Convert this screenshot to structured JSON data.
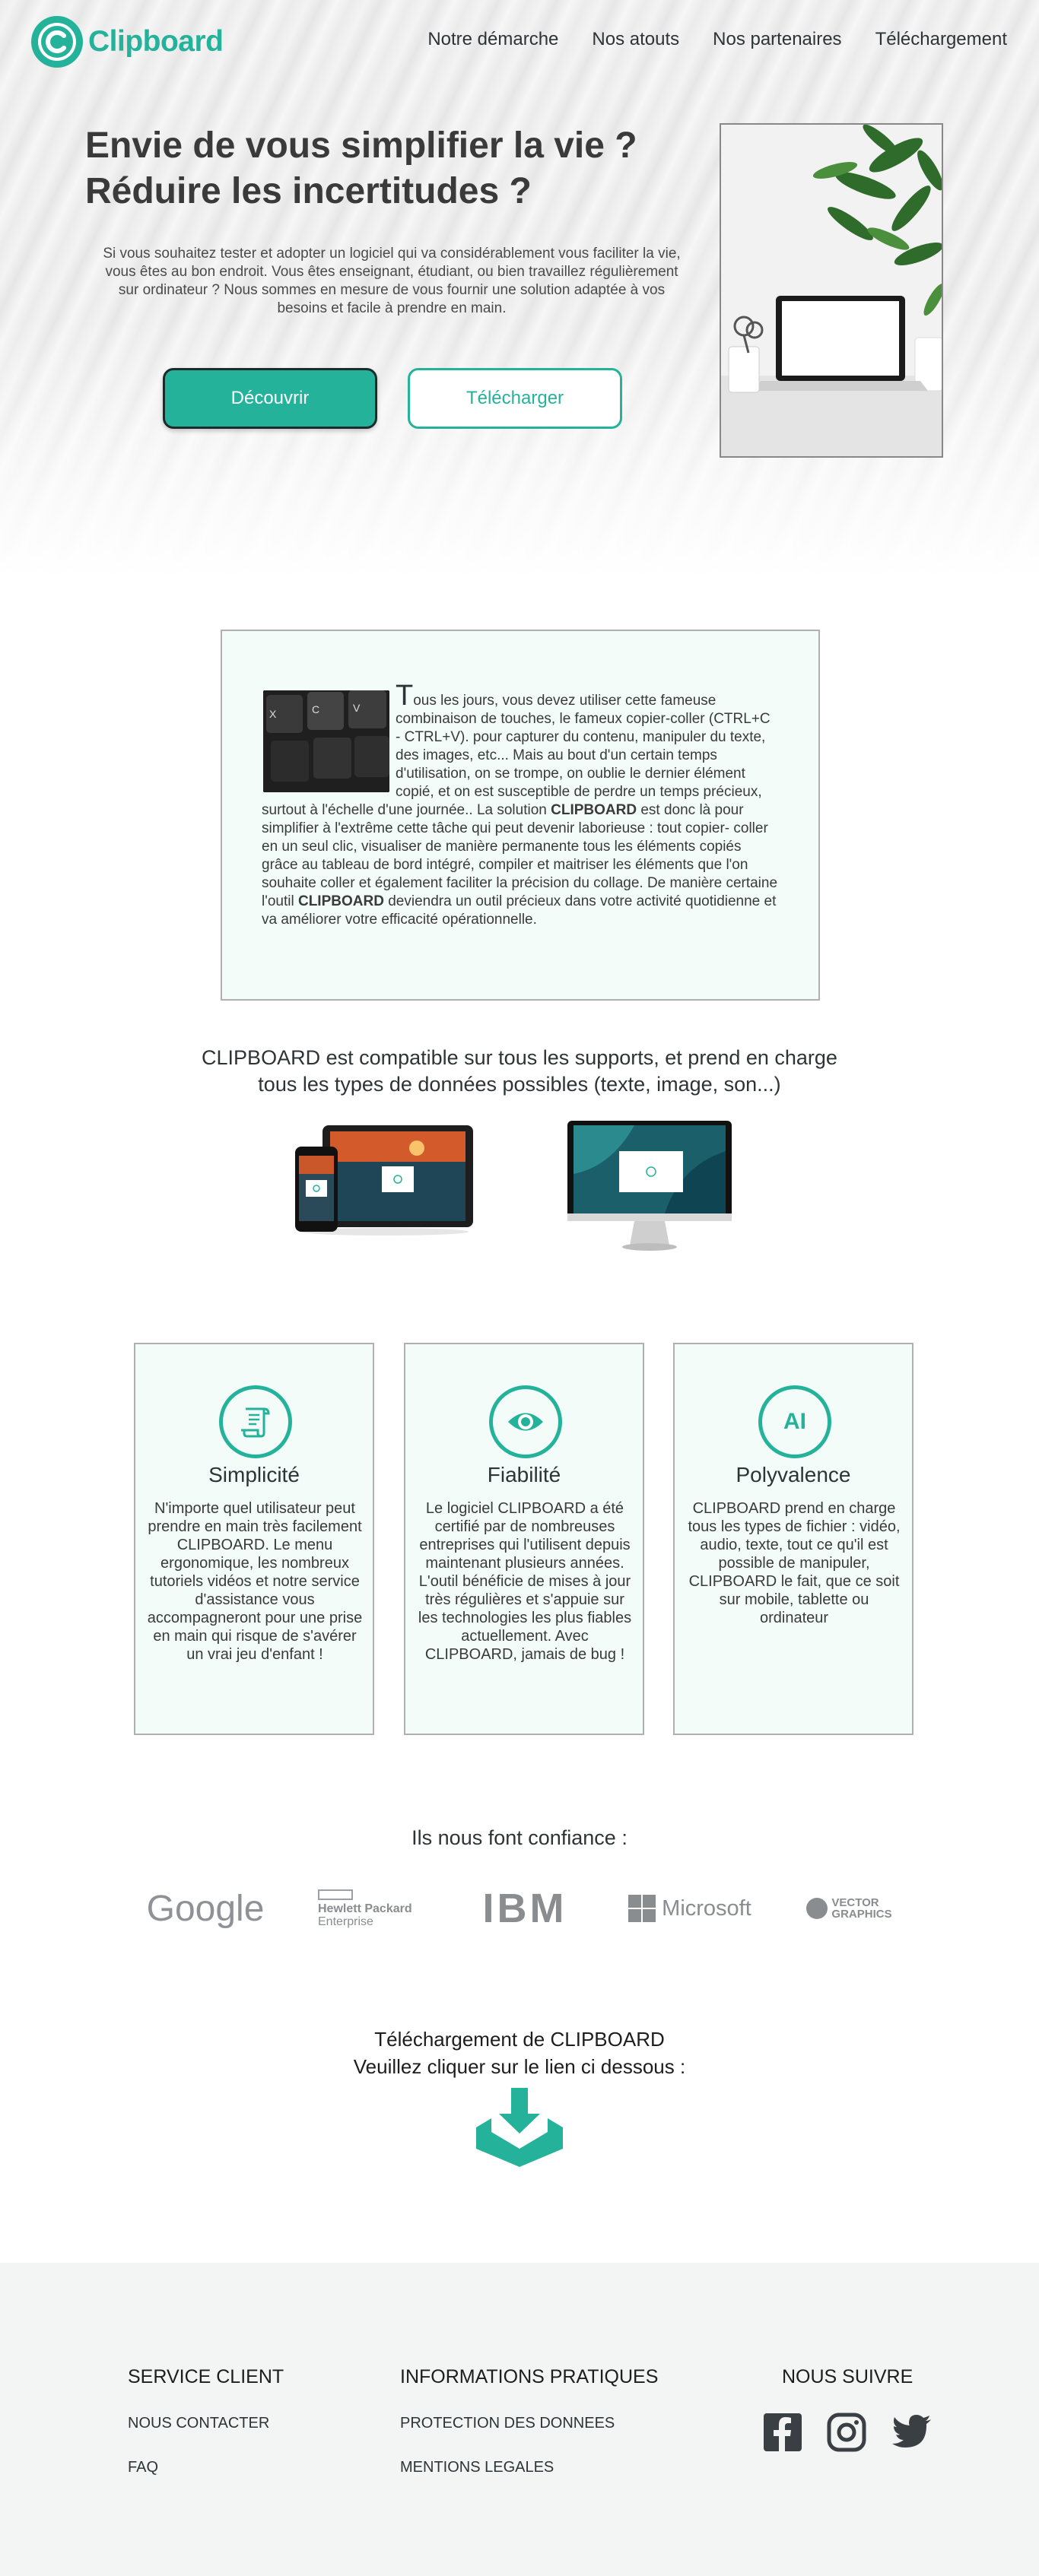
{
  "header": {
    "logo_text": "Clipboard",
    "nav": [
      "Notre démarche",
      "Nos atouts",
      "Nos partenaires",
      "Téléchargement"
    ]
  },
  "hero": {
    "title_line1": "Envie de vous simplifier la vie ?",
    "title_line2": "Réduire les incertitudes ?",
    "text": "Si vous souhaitez tester et adopter un logiciel qui va considérablement vous faciliter la vie, vous êtes au bon endroit. Vous êtes enseignant, étudiant,  ou bien travaillez régulièrement sur ordinateur ? Nous sommes en mesure de vous fournir une solution adaptée à vos besoins et facile à prendre en main.",
    "btn_discover": "Découvrir",
    "btn_download": "Télécharger"
  },
  "intro": {
    "dropcap": "T",
    "part1": "ous les jours, vous devez utiliser cette fameuse combinaison de touches, le fameux copier-coller (CTRL+C - CTRL+V). pour capturer du contenu, manipuler du texte, des images, etc... Mais au bout d'un certain temps d'utilisation, on se trompe, on oublie le dernier élément copié, et on est susceptible de perdre un temps précieux, surtout à l'échelle d'une journée.. La solution ",
    "bold1": "CLIPBOARD",
    "part2": " est donc là pour simplifier à l'extrême cette tâche qui peut devenir laborieuse : tout copier- coller en un seul clic, visualiser de manière permanente tous les éléments copiés grâce au tableau de bord intégré, compiler et maitriser les éléments que l'on souhaite coller et également faciliter la précision du collage. De manière certaine l'outil ",
    "bold2": "CLIPBOARD",
    "part3": " deviendra un outil précieux dans votre activité quotidienne et va améliorer votre efficacité opérationnelle.",
    "keys": [
      "X",
      "C",
      "V"
    ]
  },
  "compat": {
    "line1": "CLIPBOARD est compatible sur tous les supports, et prend en charge",
    "line2": "tous les types de données possibles (texte, image, son...)"
  },
  "features": [
    {
      "icon": "scroll-icon",
      "title": "Simplicité",
      "text": "N'importe quel utilisateur peut prendre en main très facilement CLIPBOARD. Le menu ergonomique, les nombreux tutoriels vidéos et notre service d'assistance vous accompagneront pour une prise en main qui risque de s'avérer un vrai jeu d'enfant !"
    },
    {
      "icon": "eye-icon",
      "title": "Fiabilité",
      "text": "Le logiciel CLIPBOARD a été certifié par de nombreuses entreprises qui l'utilisent depuis maintenant plusieurs années. L'outil bénéficie de mises à jour très régulières et s'appuie sur les technologies les plus fiables actuellement. Avec CLIPBOARD, jamais de bug !"
    },
    {
      "icon": "text-cursor-icon",
      "title": "Polyvalence",
      "icon_text": "AI",
      "text": "CLIPBOARD prend en charge tous les types de fichier : vidéo, audio, texte, tout ce qu'il est possible de manipuler, CLIPBOARD le fait, que ce soit sur mobile, tablette ou ordinateur"
    }
  ],
  "trust": {
    "title": "Ils nous font confiance :",
    "partners": {
      "google": "Google",
      "hpe_line1": "Hewlett Packard",
      "hpe_line2": "Enterprise",
      "ibm": "IBM",
      "microsoft": "Microsoft",
      "vector_line1": "VECTOR",
      "vector_line2": "GRAPHICS"
    }
  },
  "download": {
    "line1": "Téléchargement de CLIPBOARD",
    "line2": "Veuillez cliquer sur le lien ci dessous :"
  },
  "footer": {
    "col1": {
      "title": "SERVICE CLIENT",
      "links": [
        "NOUS CONTACTER",
        "FAQ"
      ]
    },
    "col2": {
      "title": "INFORMATIONS PRATIQUES",
      "links": [
        "PROTECTION DES DONNEES",
        "MENTIONS LEGALES"
      ]
    },
    "col3": {
      "title": "NOUS SUIVRE",
      "icons": [
        "facebook-icon",
        "instagram-icon",
        "twitter-icon"
      ]
    }
  },
  "colors": {
    "accent": "#24b39a",
    "text": "#2d3436",
    "card_bg": "#f3fcf9",
    "footer_bg": "#f3f4f4"
  }
}
